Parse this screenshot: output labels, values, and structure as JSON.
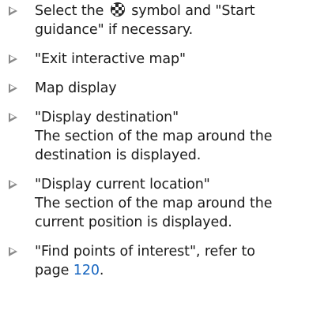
{
  "items": [
    {
      "before_icon": "Select the",
      "icon": "checkered-flag-icon",
      "after_icon": "symbol and \"Start",
      "line2": "guidance\" if necessary."
    },
    {
      "text": "\"Exit interactive map\""
    },
    {
      "text": "Map display"
    },
    {
      "line1": "\"Display destination\"",
      "line2": "The section of the map around the",
      "line3": "destination is displayed."
    },
    {
      "line1": "\"Display current location\"",
      "line2": "The section of the map around the",
      "line3": "current position is displayed."
    },
    {
      "line1": "\"Find points of interest\", refer to",
      "line2_prefix": "page",
      "page_link": "120",
      "line2_suffix": "."
    }
  ],
  "colors": {
    "text": "#1a1a1a",
    "arrow": "#8a8a8a",
    "link": "#1565c0"
  }
}
